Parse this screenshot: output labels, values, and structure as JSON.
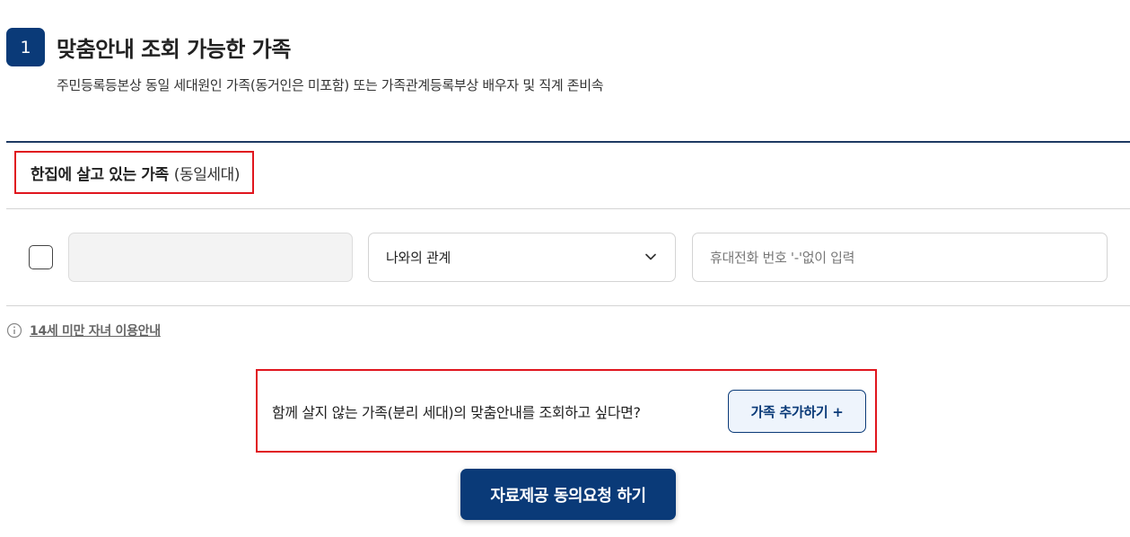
{
  "section": {
    "step_number": "1",
    "title": "맞춤안내 조회 가능한 가족",
    "description": "주민등록등본상 동일 세대원인 가족(동거인은 미포함) 또는 가족관계등록부상 배우자 및 직계 존비속"
  },
  "household": {
    "label_main": "한집에 살고 있는 가족",
    "label_sub": "(동일세대)"
  },
  "member_row": {
    "name_value": "",
    "relation_select_value": "나와의 관계",
    "phone_placeholder": "휴대전화 번호 '-'없이 입력"
  },
  "info": {
    "link_text": "14세 미만 자녀 이용안내"
  },
  "add_family": {
    "prompt_text": "함께 살지 않는 가족(분리 세대)의 맞춤안내를 조회하고 싶다면?",
    "button_label": "가족 추가하기 +"
  },
  "consent_button_label": "자료제공 동의요청 하기",
  "colors": {
    "primary_navy": "#0a3a78",
    "highlight_red": "#e0161e",
    "add_button_bg": "#eef4fc"
  },
  "icons": {
    "info": "info-circle-icon",
    "dropdown": "chevron-down-icon"
  }
}
